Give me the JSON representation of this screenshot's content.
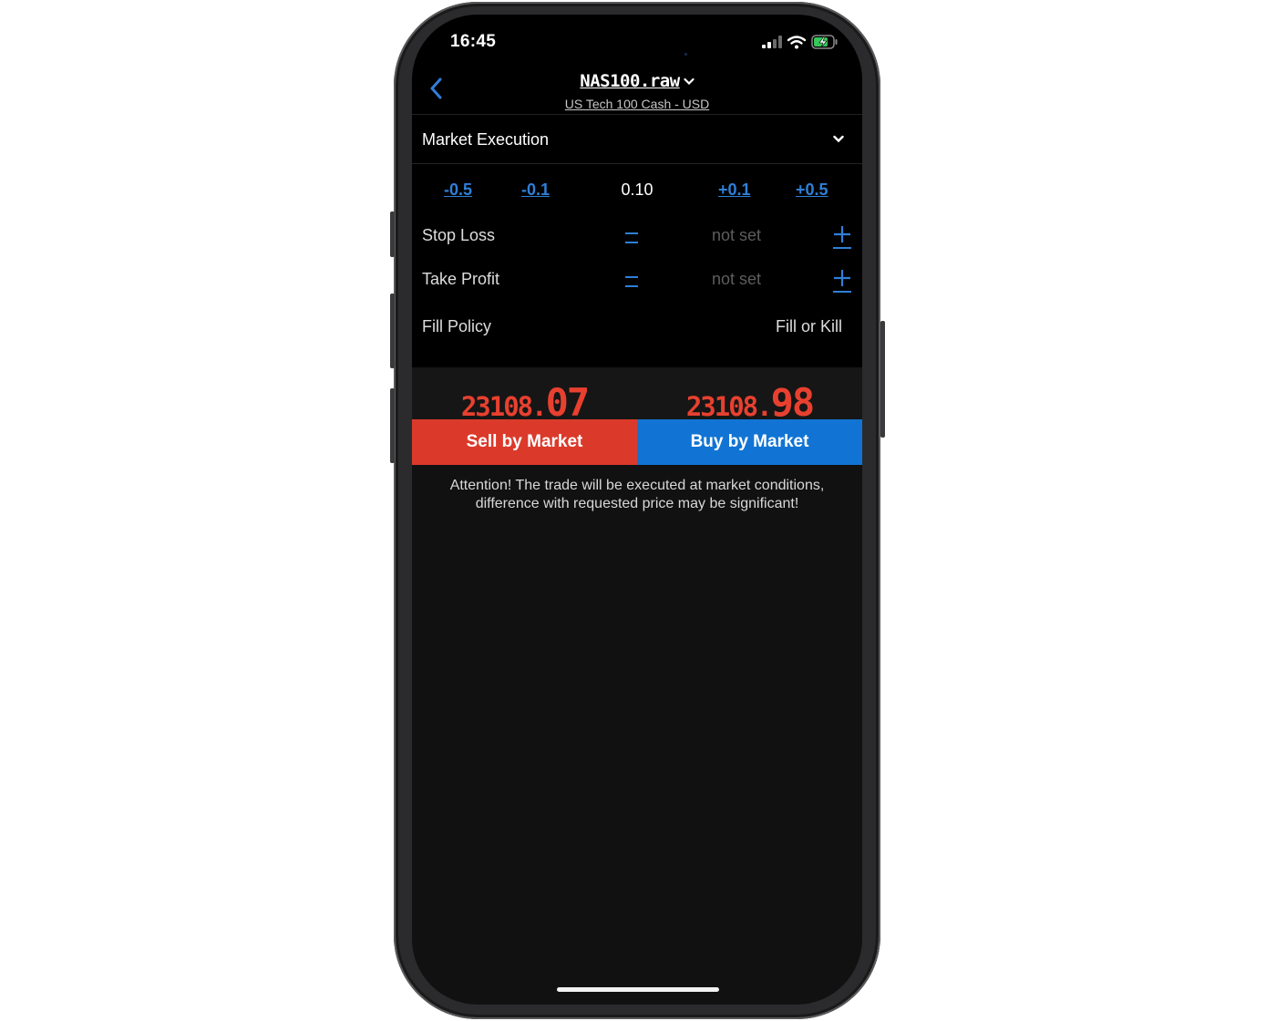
{
  "status_bar": {
    "time": "16:45"
  },
  "header": {
    "symbol": "NAS100.raw",
    "subtitle": "US Tech 100 Cash - USD"
  },
  "order_type": {
    "label": "Market Execution"
  },
  "volume": {
    "minus_large": "-0.5",
    "minus_small": "-0.1",
    "value": "0.10",
    "plus_small": "+0.1",
    "plus_large": "+0.5"
  },
  "stop_loss": {
    "label": "Stop Loss",
    "value": "not set"
  },
  "take_profit": {
    "label": "Take Profit",
    "value": "not set"
  },
  "fill_policy": {
    "label": "Fill Policy",
    "value": "Fill or Kill"
  },
  "prices": {
    "bid_main": "23108.",
    "bid_pips": "07",
    "ask_main": "23108.",
    "ask_pips": "98"
  },
  "buttons": {
    "sell": "Sell by Market",
    "buy": "Buy by Market"
  },
  "warning": {
    "line1": "Attention! The trade will be executed at market conditions,",
    "line2": "difference with requested price may be significant!"
  },
  "colors": {
    "accent_blue": "#2f7fd8",
    "sell_red": "#db3a2b",
    "buy_blue": "#1174d4",
    "price_red": "#e8402f"
  },
  "icons": [
    "back-chevron-icon",
    "dropdown-chevron-icon",
    "signal-icon",
    "wifi-icon",
    "battery-charging-icon",
    "plus-icon",
    "minus-icon"
  ]
}
